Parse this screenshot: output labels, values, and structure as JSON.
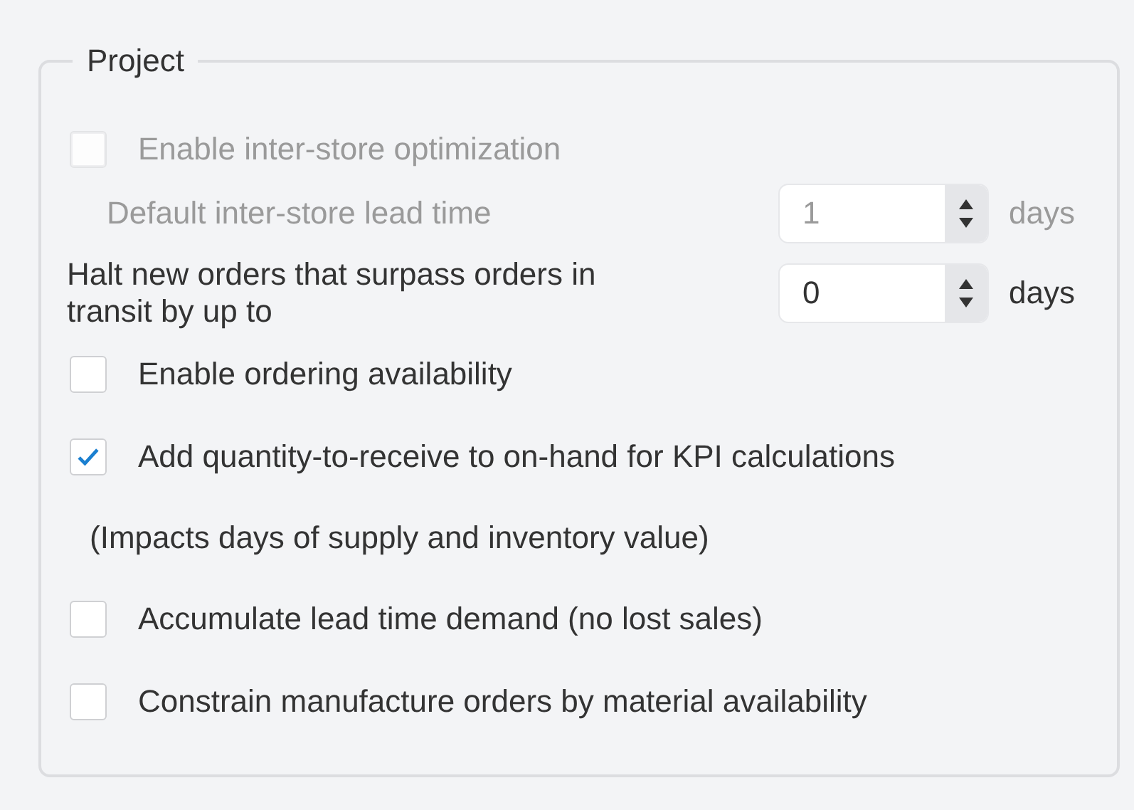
{
  "group": {
    "title": "Project"
  },
  "items": [
    {
      "kind": "checkbox",
      "label": "Enable inter-store optimization",
      "checked": false,
      "disabled": true,
      "children": [
        {
          "kind": "number",
          "label": "Default inter-store lead time",
          "value": "1",
          "unit": "days",
          "disabled": true
        }
      ]
    },
    {
      "kind": "number",
      "label": "Halt new orders that surpass orders in transit by up to",
      "value": "0",
      "unit": "days",
      "disabled": false
    },
    {
      "kind": "checkbox",
      "label": "Enable ordering availability",
      "checked": false,
      "disabled": false
    },
    {
      "kind": "checkbox",
      "label": "Add quantity-to-receive to on-hand for KPI calculations",
      "checked": true,
      "disabled": false
    },
    {
      "kind": "note",
      "label": "(Impacts days of supply and inventory value)"
    },
    {
      "kind": "checkbox",
      "label": "Accumulate lead time demand (no lost sales)",
      "checked": false,
      "disabled": false
    },
    {
      "kind": "checkbox",
      "label": "Constrain manufacture orders by material availability",
      "checked": false,
      "disabled": false
    }
  ]
}
